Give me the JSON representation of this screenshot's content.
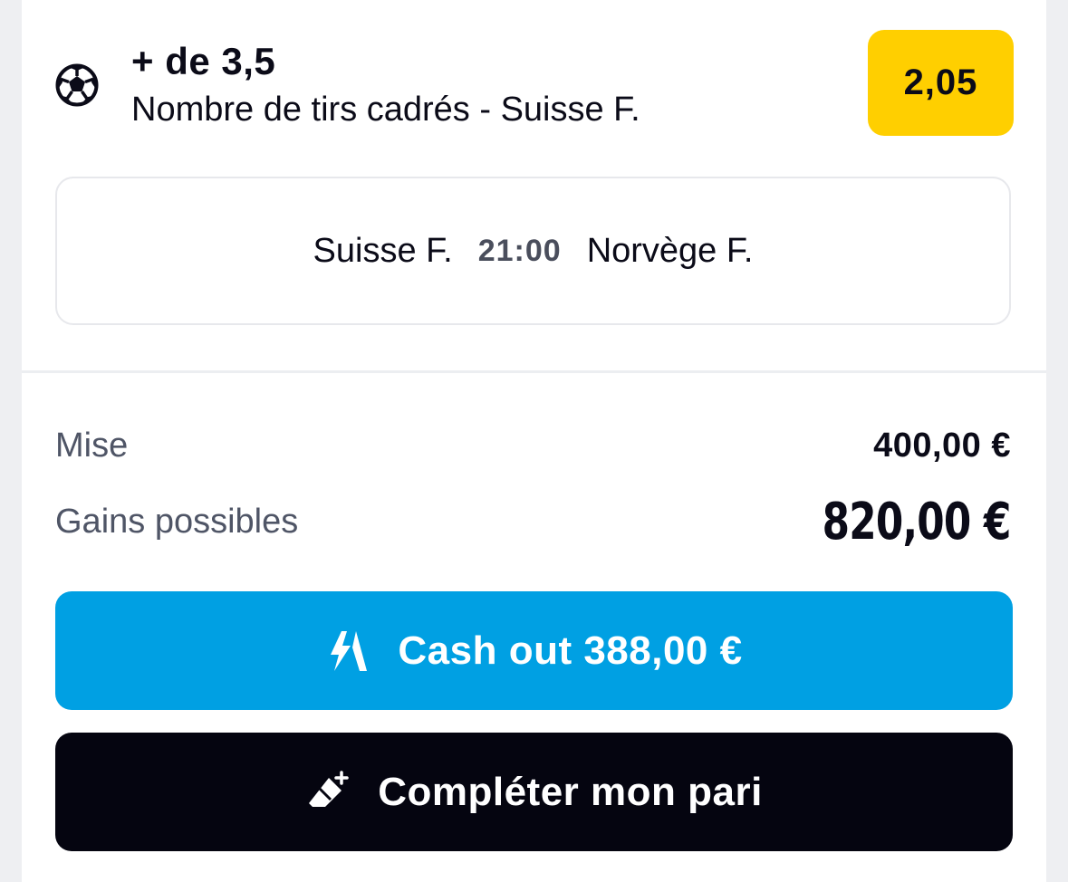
{
  "selection": {
    "icon": "soccer-ball-icon",
    "title": "+ de 3,5",
    "market": "Nombre de tirs cadrés - Suisse F.",
    "odds": "2,05",
    "odds_color": "#ffcf00"
  },
  "match": {
    "home_team": "Suisse F.",
    "time": "21:00",
    "away_team": "Norvège F."
  },
  "summary": {
    "stake_label": "Mise",
    "stake_value": "400,00 €",
    "gains_label": "Gains possibles",
    "gains_value": "820,00 €"
  },
  "actions": {
    "cashout_icon": "cashout-arrows-icon",
    "cashout_label": "Cash out 388,00 €",
    "cashout_color": "#00a0e3",
    "complete_icon": "eraser-plus-icon",
    "complete_label": "Compléter mon pari",
    "complete_color": "#050510"
  }
}
